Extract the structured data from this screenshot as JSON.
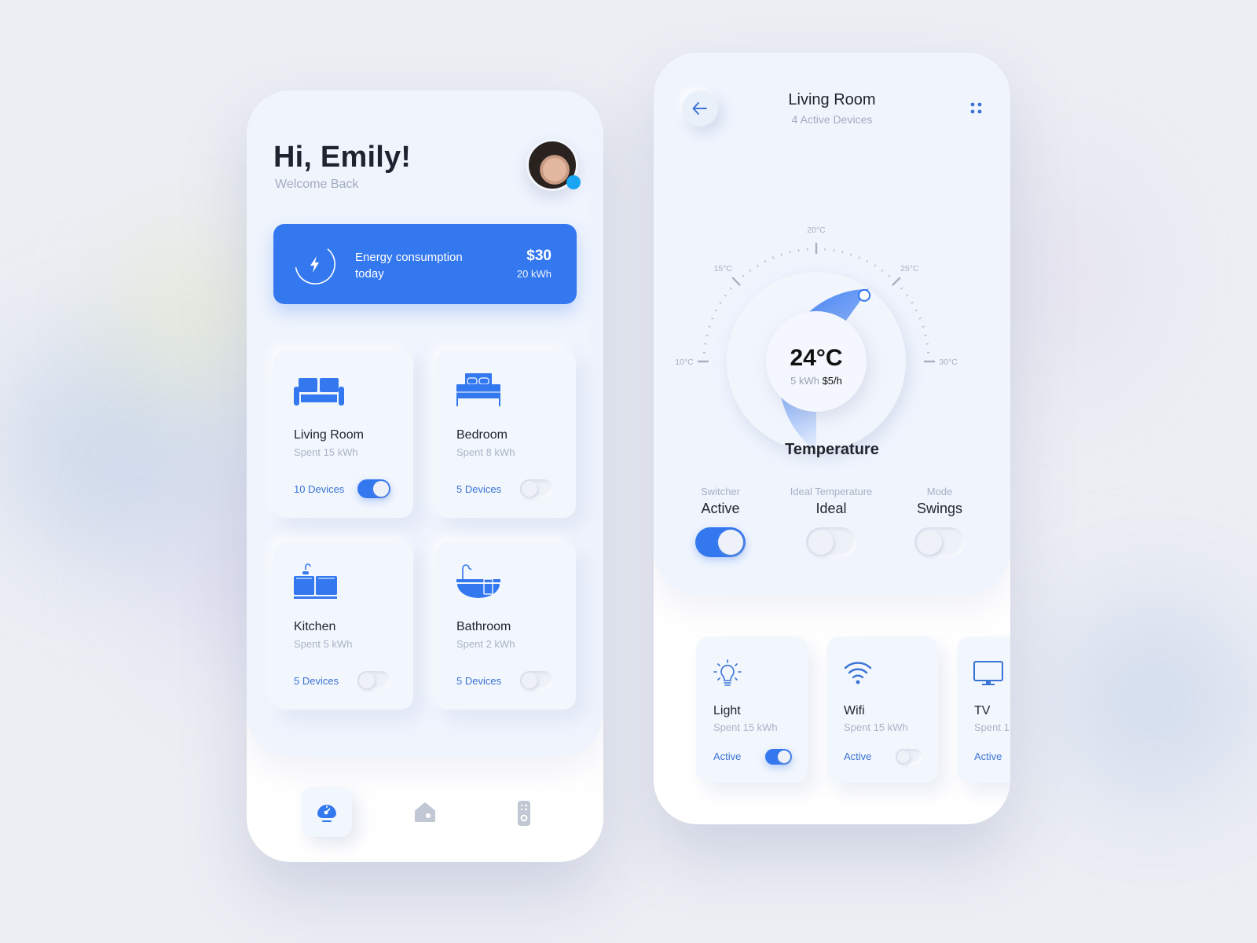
{
  "colors": {
    "accent": "#3478f0",
    "online_dot": "#1aa5f2",
    "text_dark": "#22252e",
    "text_muted": "#a2acc0",
    "link": "#3a73d6"
  },
  "home": {
    "greeting": "Hi, Emily!",
    "subtitle": "Welcome Back",
    "avatar": "user-avatar",
    "energy": {
      "label": "Energy consumption today",
      "price": "$30",
      "kwh": "20 kWh",
      "icon": "lightning-icon"
    },
    "rooms": [
      {
        "name": "Living Room",
        "spent": "Spent 15 kWh",
        "devices": "10 Devices",
        "on": true,
        "icon": "sofa-icon"
      },
      {
        "name": "Bedroom",
        "spent": "Spent 8 kWh",
        "devices": "5 Devices",
        "on": false,
        "icon": "bed-icon"
      },
      {
        "name": "Kitchen",
        "spent": "Spent 5 kWh",
        "devices": "5 Devices",
        "on": false,
        "icon": "kitchen-sink-icon"
      },
      {
        "name": "Bathroom",
        "spent": "Spent 2 kWh",
        "devices": "5 Devices",
        "on": false,
        "icon": "bathtub-icon"
      }
    ],
    "nav": [
      {
        "icon": "speedometer-icon",
        "active": true
      },
      {
        "icon": "home-icon",
        "active": false
      },
      {
        "icon": "remote-icon",
        "active": false
      }
    ]
  },
  "room_detail": {
    "title": "Living Room",
    "subtitle": "4 Active Devices",
    "thermostat": {
      "value": "24°C",
      "kwh": "5 kWh",
      "rate": "$5/h",
      "min": 10,
      "max": 30,
      "current": 24,
      "tick_labels": [
        "10°C",
        "15°C",
        "20°C",
        "25°C",
        "30°C"
      ]
    },
    "section_title": "Temperature",
    "controls": [
      {
        "label": "Switcher",
        "value": "Active",
        "on": true
      },
      {
        "label": "Ideal Temperature",
        "value": "Ideal",
        "on": false
      },
      {
        "label": "Mode",
        "value": "Swings",
        "on": false
      }
    ],
    "devices": [
      {
        "name": "Light",
        "spent": "Spent 15 kWh",
        "status": "Active",
        "on": true,
        "icon": "lightbulb-icon"
      },
      {
        "name": "Wifi",
        "spent": "Spent 15 kWh",
        "status": "Active",
        "on": false,
        "icon": "wifi-icon"
      },
      {
        "name": "TV",
        "spent": "Spent 1",
        "status": "Active",
        "on": false,
        "icon": "tv-icon"
      }
    ]
  }
}
